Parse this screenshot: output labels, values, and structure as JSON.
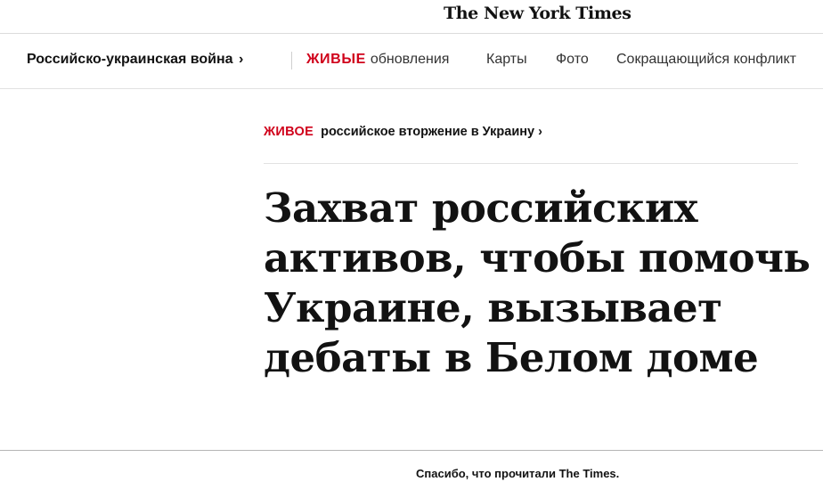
{
  "masthead": {
    "logo": "The New York Times"
  },
  "topic_bar": {
    "title": "Российско-украинская война",
    "title_chevron": "›",
    "live_tag": "ЖИВЫЕ",
    "live_label": "обновления",
    "items": [
      "Карты",
      "Фото",
      "Сокращающийся конфликт"
    ]
  },
  "article": {
    "kicker_live_tag": "ЖИВОЕ",
    "kicker_text": "российское вторжение в Украину",
    "kicker_chevron": "›",
    "headline": "Захват российских активов, чтобы помочь Украине, вызывает дебаты в Белом доме"
  },
  "footer": {
    "text": "Спасибо, что прочитали The Times."
  },
  "colors": {
    "live_red": "#d0021b",
    "text": "#121212",
    "divider": "#e2e2e2"
  }
}
